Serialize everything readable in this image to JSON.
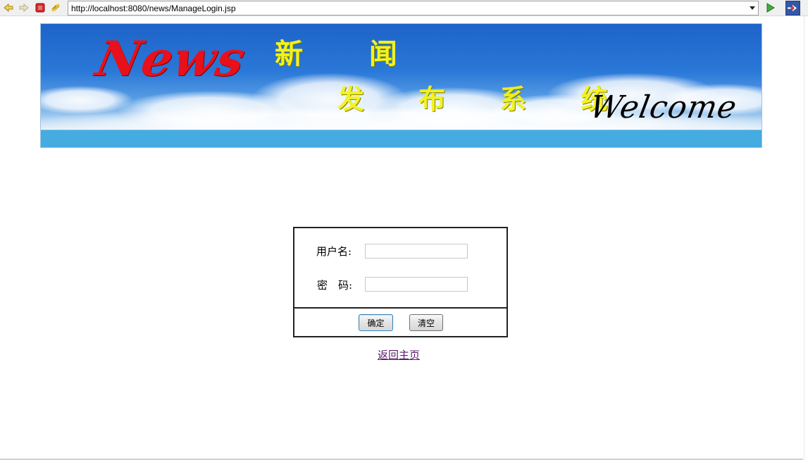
{
  "browser": {
    "url": "http://localhost:8080/news/ManageLogin.jsp"
  },
  "banner": {
    "logo_text": "News",
    "title_line1": "新 闻",
    "title_line2": "发 布 系 统",
    "welcome_text": "Welcome"
  },
  "login": {
    "username_label": "用户名:",
    "username_value": "",
    "password_label": "密　码:",
    "password_value": "",
    "confirm_button": "确定",
    "clear_button": "清空"
  },
  "back_link": "返回主页",
  "colors": {
    "sky": "#2a78d8",
    "stripe": "#45ace1",
    "logo_red": "#e8101a",
    "title_yellow": "#f3f31a",
    "link_visited": "#5a1a6e"
  }
}
